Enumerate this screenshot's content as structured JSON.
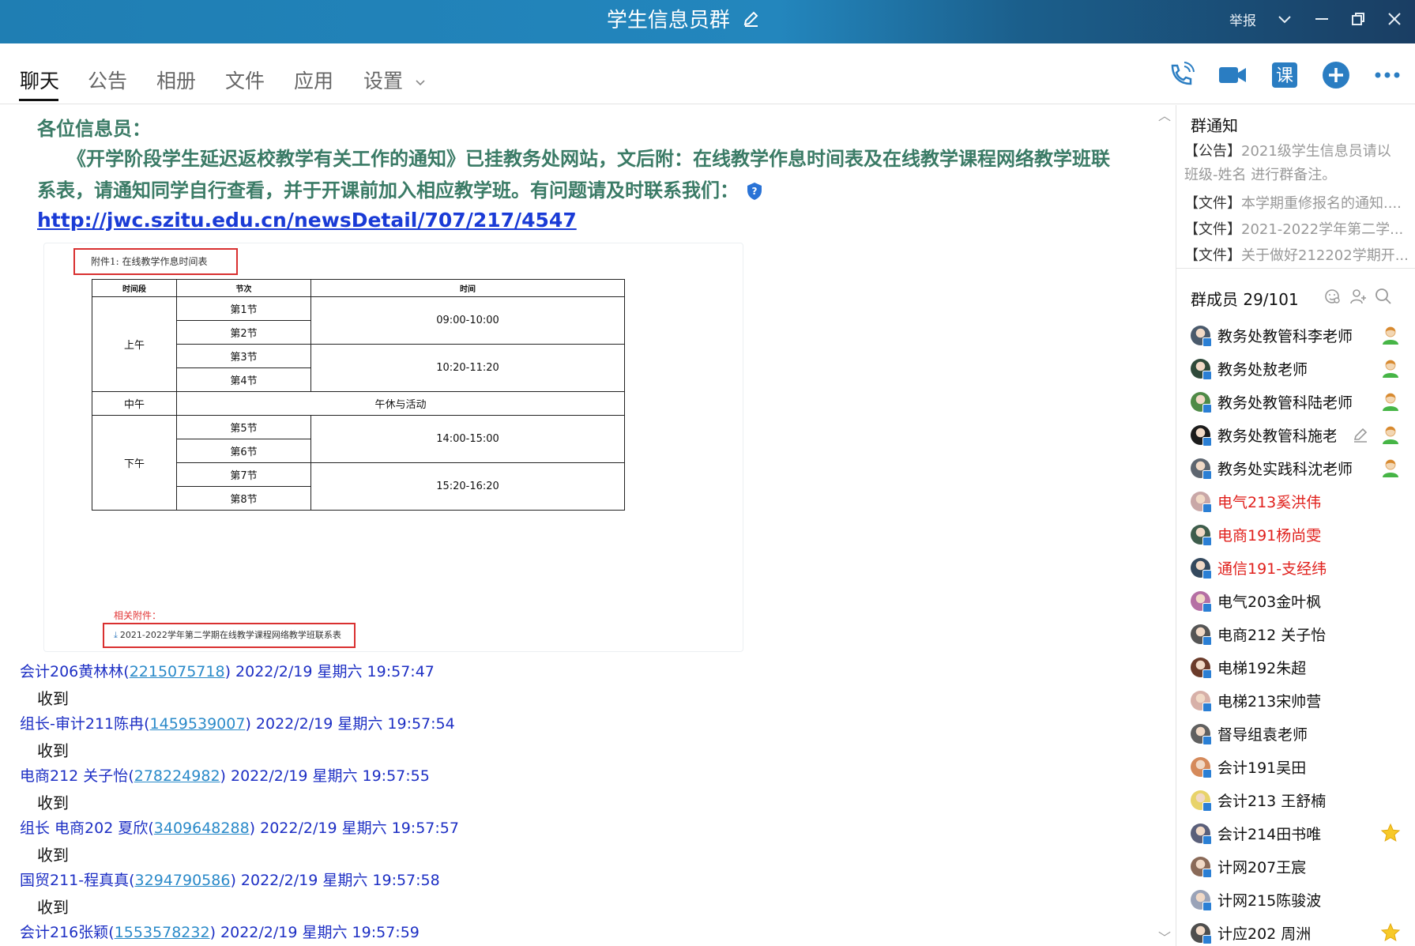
{
  "window": {
    "title": "学生信息员群",
    "report_label": "举报"
  },
  "tabs": [
    {
      "label": "聊天",
      "active": true
    },
    {
      "label": "公告"
    },
    {
      "label": "相册"
    },
    {
      "label": "文件"
    },
    {
      "label": "应用"
    },
    {
      "label": "设置"
    }
  ],
  "toolbar": {
    "course_label": "课",
    "accent_color": "#2a7dc2"
  },
  "notice": {
    "greeting": "各位信息员：",
    "paragraph": "《开学阶段学生延迟返校教学有关工作的通知》已挂教务处网站，文后附：在线教学作息时间表及在线教学课程网络教学班联系表，请通知同学自行查看，并于开课前加入相应教学班。有问题请及时联系我们：",
    "link": "http://jwc.szitu.edu.cn/newsDetail/707/217/4547"
  },
  "attachment_image": {
    "caption": "附件1: 在线教学作息时间表",
    "headers": [
      "时间段",
      "节次",
      "时间"
    ],
    "morning": "上午",
    "noon": "中午",
    "afternoon": "下午",
    "noon_text": "午休与活动",
    "periods": [
      "第1节",
      "第2节",
      "第3节",
      "第4节",
      "第5节",
      "第6节",
      "第7节",
      "第8节"
    ],
    "times": [
      "09:00-10:00",
      "10:20-11:20",
      "14:00-15:00",
      "15:20-16:20"
    ],
    "related_label": "相关附件：",
    "related_file": "2021-2022学年第二学期在线教学课程网络教学班联系表"
  },
  "messages": [
    {
      "name": "会计206黄林林",
      "qq": "2215075718",
      "time": "2022/2/19 星期六 19:57:47",
      "body": "收到"
    },
    {
      "name": "组长-审计211陈冉",
      "qq": "1459539007",
      "time": "2022/2/19 星期六 19:57:54",
      "body": "收到"
    },
    {
      "name": "电商212 关子怡",
      "qq": "278224982",
      "time": "2022/2/19 星期六 19:57:55",
      "body": "收到"
    },
    {
      "name": "组长  电商202 夏欣",
      "qq": "3409648288",
      "time": "2022/2/19 星期六 19:57:57",
      "body": "收到"
    },
    {
      "name": "国贸211-程真真",
      "qq": "3294790586",
      "time": "2022/2/19 星期六 19:57:58",
      "body": "收到"
    },
    {
      "name": "会计216张颖",
      "qq": "1553578232",
      "time": "2022/2/19 星期六 19:57:59",
      "body": ""
    }
  ],
  "side": {
    "notice_title": "群通知",
    "announcement_tag": "【公告】",
    "announcement_text": "2021级学生信息员请以",
    "announcement_text2": "班级-姓名 进行群备注。",
    "files": [
      {
        "tag": "【文件】",
        "text": "本学期重修报名的通知...."
      },
      {
        "tag": "【文件】",
        "text": "2021-2022学年第二学..."
      },
      {
        "tag": "【文件】",
        "text": "关于做好212202学期开..."
      }
    ],
    "members_title": "群成员 29/101",
    "members": [
      {
        "name": "教务处教管科李老师",
        "red": false,
        "badge": "admin",
        "color": "#4a5a6c"
      },
      {
        "name": "教务处敖老师",
        "red": false,
        "badge": "admin",
        "color": "#2f4a3a"
      },
      {
        "name": "教务处教管科陆老师",
        "red": false,
        "badge": "admin",
        "color": "#4f8a47"
      },
      {
        "name": "教务处教管科施老",
        "red": false,
        "badge": "admin",
        "color": "#1c1c1c"
      },
      {
        "name": "教务处实践科沈老师",
        "red": false,
        "badge": "admin",
        "color": "#5e6670"
      },
      {
        "name": "电气213奚洪伟",
        "red": true,
        "badge": "",
        "color": "#c9a7a7"
      },
      {
        "name": "电商191杨尚雯",
        "red": true,
        "badge": "",
        "color": "#3e5d4c"
      },
      {
        "name": "通信191-支经纬",
        "red": true,
        "badge": "",
        "color": "#34495e"
      },
      {
        "name": "电气203金叶枫",
        "red": false,
        "badge": "",
        "color": "#b56fa4"
      },
      {
        "name": "电商212 关子怡",
        "red": false,
        "badge": "",
        "color": "#555"
      },
      {
        "name": "电梯192朱超",
        "red": false,
        "badge": "",
        "color": "#6b3b2a"
      },
      {
        "name": "电梯213宋帅营",
        "red": false,
        "badge": "",
        "color": "#d7b0a8"
      },
      {
        "name": "督导组袁老师",
        "red": false,
        "badge": "",
        "color": "#606060"
      },
      {
        "name": "会计191吴田",
        "red": false,
        "badge": "",
        "color": "#d58a5b"
      },
      {
        "name": "会计213 王舒楠",
        "red": false,
        "badge": "",
        "color": "#e8d36a"
      },
      {
        "name": "会计214田书唯",
        "red": false,
        "badge": "star",
        "color": "#5a5f7a"
      },
      {
        "name": "计网207王宸",
        "red": false,
        "badge": "",
        "color": "#8a6a58"
      },
      {
        "name": "计网215陈骏波",
        "red": false,
        "badge": "",
        "color": "#9aa3b8"
      },
      {
        "name": "计应202 周洲",
        "red": false,
        "badge": "star",
        "color": "#4e4e4e"
      }
    ]
  }
}
